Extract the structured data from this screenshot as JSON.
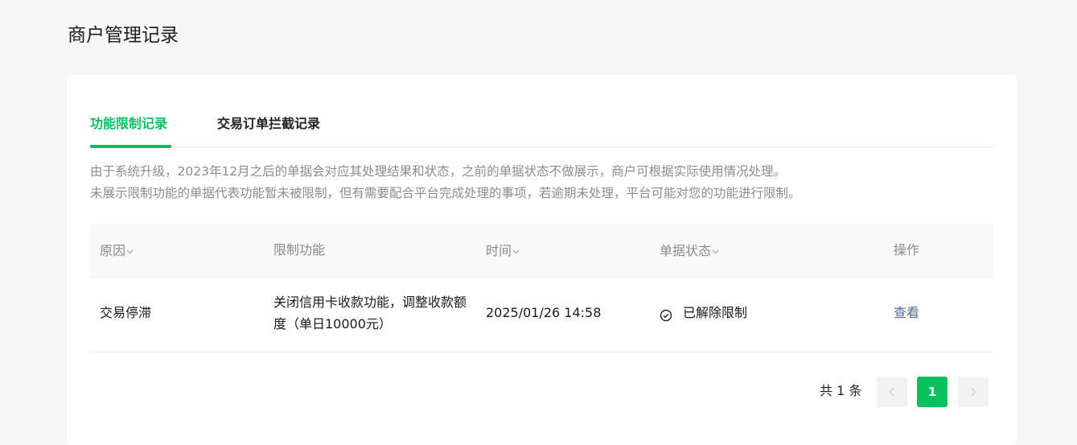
{
  "page": {
    "title": "商户管理记录"
  },
  "tabs": [
    {
      "label": "功能限制记录",
      "active": true
    },
    {
      "label": "交易订单拦截记录",
      "active": false
    }
  ],
  "notice": {
    "line1": "由于系统升级，2023年12月之后的单据会对应其处理结果和状态，之前的单据状态不做展示，商户可根据实际使用情况处理。",
    "line2": "未展示限制功能的单据代表功能暂未被限制，但有需要配合平台完成处理的事项，若逾期未处理，平台可能对您的功能进行限制。"
  },
  "table": {
    "headers": [
      {
        "label": "原因",
        "sortable": true
      },
      {
        "label": "限制功能",
        "sortable": false
      },
      {
        "label": "时间",
        "sortable": true
      },
      {
        "label": "单据状态",
        "sortable": true
      },
      {
        "label": "操作",
        "sortable": false
      }
    ],
    "rows": [
      {
        "reason": "交易停滞",
        "restriction": "关闭信用卡收款功能，调整收款额度（单日10000元）",
        "time": "2025/01/26 14:58",
        "status": "已解除限制",
        "status_icon": "check-circle-icon",
        "action": "查看"
      }
    ]
  },
  "pagination": {
    "total_text": "共 1 条",
    "current_page": "1",
    "prev_icon": "chevron-left-icon",
    "next_icon": "chevron-right-icon"
  },
  "colors": {
    "accent": "#07c160",
    "link": "#576b95",
    "muted_text": "#8c8c8c"
  }
}
